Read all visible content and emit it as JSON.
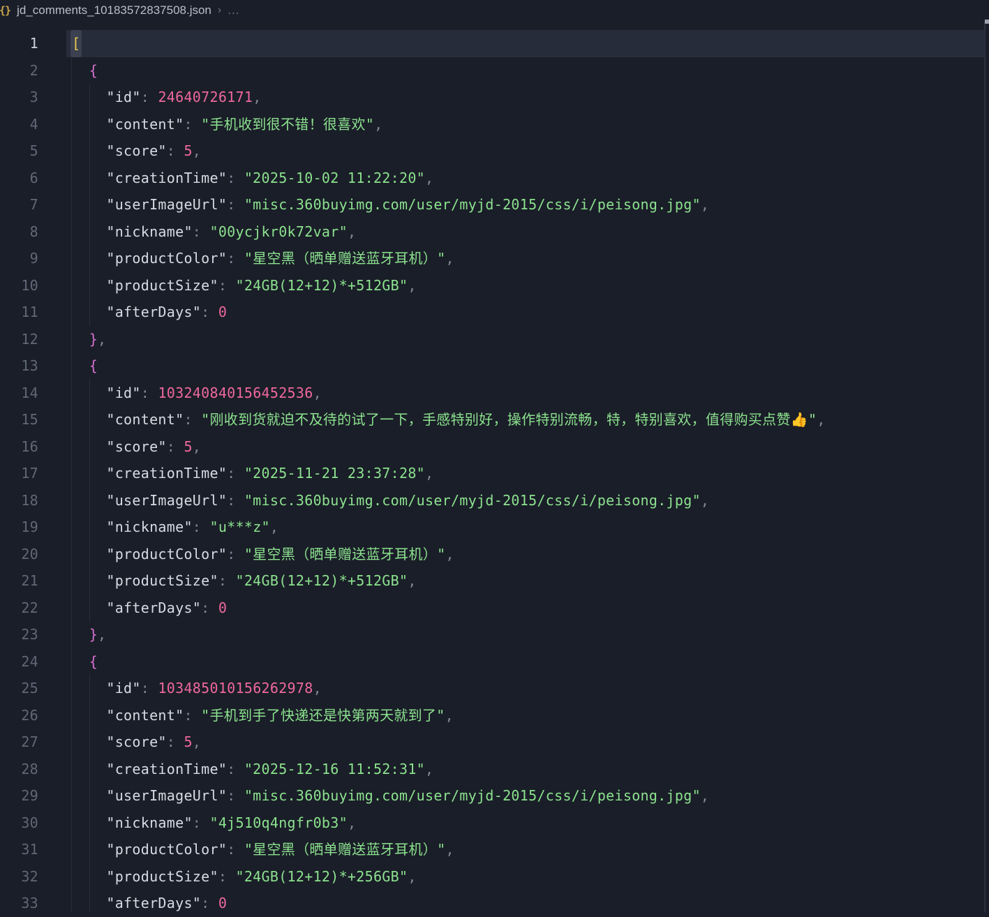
{
  "breadcrumb": {
    "icon_glyph": "{}",
    "file_name": "jd_comments_10183572837508.json",
    "separator": "›",
    "ellipsis": "..."
  },
  "colors": {
    "background": "#1a1e28",
    "current_line": "#272c3a",
    "string": "#8ce28f",
    "number": "#ef689e",
    "property_key": "#d7dbe4",
    "punctuation": "#7e8899",
    "bracket_level0": "#e9c94f",
    "bracket_level1": "#d670d0"
  },
  "editor": {
    "active_line": 1,
    "lines": [
      {
        "n": 1,
        "segs": [
          [
            "b1m",
            "["
          ]
        ]
      },
      {
        "n": 2,
        "segs": [
          [
            "ws",
            "  "
          ],
          [
            "b2",
            "{"
          ]
        ]
      },
      {
        "n": 3,
        "segs": [
          [
            "ws",
            "    "
          ],
          [
            "key",
            "\"id\""
          ],
          [
            "punc",
            ": "
          ],
          [
            "num",
            "24640726171"
          ],
          [
            "punc",
            ","
          ]
        ]
      },
      {
        "n": 4,
        "segs": [
          [
            "ws",
            "    "
          ],
          [
            "key",
            "\"content\""
          ],
          [
            "punc",
            ": "
          ],
          [
            "str",
            "\"手机收到很不错！很喜欢\""
          ],
          [
            "punc",
            ","
          ]
        ]
      },
      {
        "n": 5,
        "segs": [
          [
            "ws",
            "    "
          ],
          [
            "key",
            "\"score\""
          ],
          [
            "punc",
            ": "
          ],
          [
            "num",
            "5"
          ],
          [
            "punc",
            ","
          ]
        ]
      },
      {
        "n": 6,
        "segs": [
          [
            "ws",
            "    "
          ],
          [
            "key",
            "\"creationTime\""
          ],
          [
            "punc",
            ": "
          ],
          [
            "str",
            "\"2025-10-02 11:22:20\""
          ],
          [
            "punc",
            ","
          ]
        ]
      },
      {
        "n": 7,
        "segs": [
          [
            "ws",
            "    "
          ],
          [
            "key",
            "\"userImageUrl\""
          ],
          [
            "punc",
            ": "
          ],
          [
            "str",
            "\"misc.360buyimg.com/user/myjd-2015/css/i/peisong.jpg\""
          ],
          [
            "punc",
            ","
          ]
        ]
      },
      {
        "n": 8,
        "segs": [
          [
            "ws",
            "    "
          ],
          [
            "key",
            "\"nickname\""
          ],
          [
            "punc",
            ": "
          ],
          [
            "str",
            "\"00ycjkr0k72var\""
          ],
          [
            "punc",
            ","
          ]
        ]
      },
      {
        "n": 9,
        "segs": [
          [
            "ws",
            "    "
          ],
          [
            "key",
            "\"productColor\""
          ],
          [
            "punc",
            ": "
          ],
          [
            "str",
            "\"星空黑（晒单赠送蓝牙耳机）\""
          ],
          [
            "punc",
            ","
          ]
        ]
      },
      {
        "n": 10,
        "segs": [
          [
            "ws",
            "    "
          ],
          [
            "key",
            "\"productSize\""
          ],
          [
            "punc",
            ": "
          ],
          [
            "str",
            "\"24GB(12+12)*+512GB\""
          ],
          [
            "punc",
            ","
          ]
        ]
      },
      {
        "n": 11,
        "segs": [
          [
            "ws",
            "    "
          ],
          [
            "key",
            "\"afterDays\""
          ],
          [
            "punc",
            ": "
          ],
          [
            "num",
            "0"
          ]
        ]
      },
      {
        "n": 12,
        "segs": [
          [
            "ws",
            "  "
          ],
          [
            "b2",
            "}"
          ],
          [
            "punc",
            ","
          ]
        ]
      },
      {
        "n": 13,
        "segs": [
          [
            "ws",
            "  "
          ],
          [
            "b2",
            "{"
          ]
        ]
      },
      {
        "n": 14,
        "segs": [
          [
            "ws",
            "    "
          ],
          [
            "key",
            "\"id\""
          ],
          [
            "punc",
            ": "
          ],
          [
            "num",
            "103240840156452536"
          ],
          [
            "punc",
            ","
          ]
        ]
      },
      {
        "n": 15,
        "segs": [
          [
            "ws",
            "    "
          ],
          [
            "key",
            "\"content\""
          ],
          [
            "punc",
            ": "
          ],
          [
            "str",
            "\"刚收到货就迫不及待的试了一下，手感特别好，操作特别流畅，特，特别喜欢，值得购买点赞👍\""
          ],
          [
            "punc",
            ","
          ]
        ]
      },
      {
        "n": 16,
        "segs": [
          [
            "ws",
            "    "
          ],
          [
            "key",
            "\"score\""
          ],
          [
            "punc",
            ": "
          ],
          [
            "num",
            "5"
          ],
          [
            "punc",
            ","
          ]
        ]
      },
      {
        "n": 17,
        "segs": [
          [
            "ws",
            "    "
          ],
          [
            "key",
            "\"creationTime\""
          ],
          [
            "punc",
            ": "
          ],
          [
            "str",
            "\"2025-11-21 23:37:28\""
          ],
          [
            "punc",
            ","
          ]
        ]
      },
      {
        "n": 18,
        "segs": [
          [
            "ws",
            "    "
          ],
          [
            "key",
            "\"userImageUrl\""
          ],
          [
            "punc",
            ": "
          ],
          [
            "str",
            "\"misc.360buyimg.com/user/myjd-2015/css/i/peisong.jpg\""
          ],
          [
            "punc",
            ","
          ]
        ]
      },
      {
        "n": 19,
        "segs": [
          [
            "ws",
            "    "
          ],
          [
            "key",
            "\"nickname\""
          ],
          [
            "punc",
            ": "
          ],
          [
            "str",
            "\"u***z\""
          ],
          [
            "punc",
            ","
          ]
        ]
      },
      {
        "n": 20,
        "segs": [
          [
            "ws",
            "    "
          ],
          [
            "key",
            "\"productColor\""
          ],
          [
            "punc",
            ": "
          ],
          [
            "str",
            "\"星空黑（晒单赠送蓝牙耳机）\""
          ],
          [
            "punc",
            ","
          ]
        ]
      },
      {
        "n": 21,
        "segs": [
          [
            "ws",
            "    "
          ],
          [
            "key",
            "\"productSize\""
          ],
          [
            "punc",
            ": "
          ],
          [
            "str",
            "\"24GB(12+12)*+512GB\""
          ],
          [
            "punc",
            ","
          ]
        ]
      },
      {
        "n": 22,
        "segs": [
          [
            "ws",
            "    "
          ],
          [
            "key",
            "\"afterDays\""
          ],
          [
            "punc",
            ": "
          ],
          [
            "num",
            "0"
          ]
        ]
      },
      {
        "n": 23,
        "segs": [
          [
            "ws",
            "  "
          ],
          [
            "b2",
            "}"
          ],
          [
            "punc",
            ","
          ]
        ]
      },
      {
        "n": 24,
        "segs": [
          [
            "ws",
            "  "
          ],
          [
            "b2",
            "{"
          ]
        ]
      },
      {
        "n": 25,
        "segs": [
          [
            "ws",
            "    "
          ],
          [
            "key",
            "\"id\""
          ],
          [
            "punc",
            ": "
          ],
          [
            "num",
            "103485010156262978"
          ],
          [
            "punc",
            ","
          ]
        ]
      },
      {
        "n": 26,
        "segs": [
          [
            "ws",
            "    "
          ],
          [
            "key",
            "\"content\""
          ],
          [
            "punc",
            ": "
          ],
          [
            "str",
            "\"手机到手了快递还是快第两天就到了\""
          ],
          [
            "punc",
            ","
          ]
        ]
      },
      {
        "n": 27,
        "segs": [
          [
            "ws",
            "    "
          ],
          [
            "key",
            "\"score\""
          ],
          [
            "punc",
            ": "
          ],
          [
            "num",
            "5"
          ],
          [
            "punc",
            ","
          ]
        ]
      },
      {
        "n": 28,
        "segs": [
          [
            "ws",
            "    "
          ],
          [
            "key",
            "\"creationTime\""
          ],
          [
            "punc",
            ": "
          ],
          [
            "str",
            "\"2025-12-16 11:52:31\""
          ],
          [
            "punc",
            ","
          ]
        ]
      },
      {
        "n": 29,
        "segs": [
          [
            "ws",
            "    "
          ],
          [
            "key",
            "\"userImageUrl\""
          ],
          [
            "punc",
            ": "
          ],
          [
            "str",
            "\"misc.360buyimg.com/user/myjd-2015/css/i/peisong.jpg\""
          ],
          [
            "punc",
            ","
          ]
        ]
      },
      {
        "n": 30,
        "segs": [
          [
            "ws",
            "    "
          ],
          [
            "key",
            "\"nickname\""
          ],
          [
            "punc",
            ": "
          ],
          [
            "str",
            "\"4j510q4ngfr0b3\""
          ],
          [
            "punc",
            ","
          ]
        ]
      },
      {
        "n": 31,
        "segs": [
          [
            "ws",
            "    "
          ],
          [
            "key",
            "\"productColor\""
          ],
          [
            "punc",
            ": "
          ],
          [
            "str",
            "\"星空黑（晒单赠送蓝牙耳机）\""
          ],
          [
            "punc",
            ","
          ]
        ]
      },
      {
        "n": 32,
        "segs": [
          [
            "ws",
            "    "
          ],
          [
            "key",
            "\"productSize\""
          ],
          [
            "punc",
            ": "
          ],
          [
            "str",
            "\"24GB(12+12)*+256GB\""
          ],
          [
            "punc",
            ","
          ]
        ]
      },
      {
        "n": 33,
        "segs": [
          [
            "ws",
            "    "
          ],
          [
            "key",
            "\"afterDays\""
          ],
          [
            "punc",
            ": "
          ],
          [
            "num",
            "0"
          ]
        ]
      }
    ]
  }
}
